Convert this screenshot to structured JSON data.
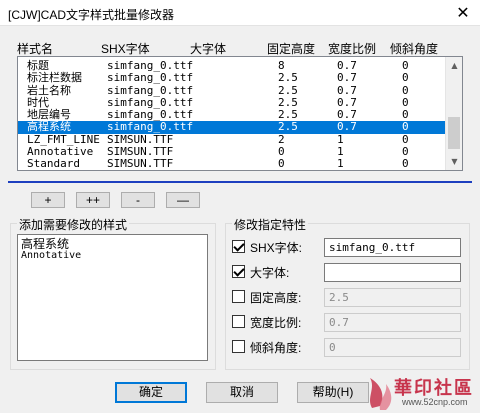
{
  "window": {
    "title": "[CJW]CAD文字样式批量修改器",
    "close_glyph": "✕"
  },
  "columns": [
    "样式名",
    "SHX字体",
    "大字体",
    "固定高度",
    "宽度比例",
    "倾斜角度"
  ],
  "styles": [
    {
      "name": "标题",
      "shx": "simfang_0.ttf",
      "big": "",
      "height": "8",
      "width": "0.7",
      "oblique": "0"
    },
    {
      "name": "标注栏数据",
      "shx": "simfang_0.ttf",
      "big": "",
      "height": "2.5",
      "width": "0.7",
      "oblique": "0"
    },
    {
      "name": "岩土名称",
      "shx": "simfang_0.ttf",
      "big": "",
      "height": "2.5",
      "width": "0.7",
      "oblique": "0"
    },
    {
      "name": "时代",
      "shx": "simfang_0.ttf",
      "big": "",
      "height": "2.5",
      "width": "0.7",
      "oblique": "0"
    },
    {
      "name": "地层编号",
      "shx": "simfang_0.ttf",
      "big": "",
      "height": "2.5",
      "width": "0.7",
      "oblique": "0"
    },
    {
      "name": "高程系统",
      "shx": "simfang_0.ttf",
      "big": "",
      "height": "2.5",
      "width": "0.7",
      "oblique": "0",
      "selected": true
    },
    {
      "name": "LZ_FMT_LINE",
      "shx": "SIMSUN.TTF",
      "big": "",
      "height": "2",
      "width": "1",
      "oblique": "0"
    },
    {
      "name": "Annotative",
      "shx": "SIMSUN.TTF",
      "big": "",
      "height": "0",
      "width": "1",
      "oblique": "0"
    },
    {
      "name": "Standard",
      "shx": "SIMSUN.TTF",
      "big": "",
      "height": "0",
      "width": "1",
      "oblique": "0"
    }
  ],
  "list_buttons": {
    "add": "+",
    "add_all": "++",
    "remove": "-",
    "remove_all": "—"
  },
  "selected_group": {
    "title": "添加需要修改的样式",
    "items": [
      "高程系统",
      "Annotative"
    ]
  },
  "props_group": {
    "title": "修改指定特性",
    "shx": {
      "label": "SHX字体:",
      "checked": true,
      "value": "simfang_0.ttf"
    },
    "big": {
      "label": "大字体:",
      "checked": true,
      "value": ""
    },
    "height": {
      "label": "固定高度:",
      "checked": false,
      "value": "2.5"
    },
    "width": {
      "label": "宽度比例:",
      "checked": false,
      "value": "0.7"
    },
    "oblique": {
      "label": "倾斜角度:",
      "checked": false,
      "value": "0"
    }
  },
  "footer": {
    "ok": "确定",
    "cancel": "取消",
    "help": "帮助(H)"
  },
  "watermark": {
    "text": "華印社區",
    "url": "www.52cnp.com"
  },
  "colors": {
    "selection": "#0078d7",
    "divider": "#1d3fbf",
    "watermark": "#c7344c"
  }
}
